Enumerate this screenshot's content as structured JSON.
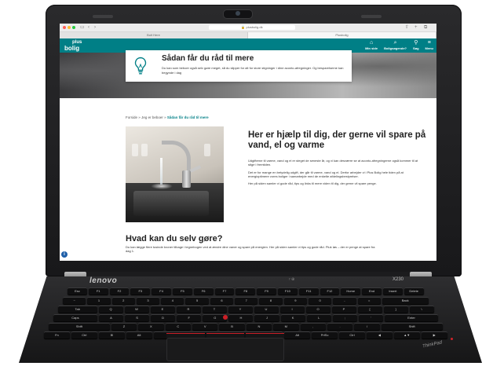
{
  "browser": {
    "url": "plusbolig.dk",
    "tabs": [
      {
        "label": "Bolt Here"
      },
      {
        "label": "Plusbolig"
      }
    ]
  },
  "site_nav": {
    "logo_plus": "plus",
    "logo_bolig": "bolig",
    "items": [
      {
        "icon": "user-icon",
        "glyph": "⌂",
        "label": "Min side"
      },
      {
        "icon": "search-house-icon",
        "glyph": "⌕",
        "label": "Boligsøgende?"
      },
      {
        "icon": "search-icon",
        "glyph": "⚲",
        "label": "Søg"
      },
      {
        "icon": "menu-icon",
        "glyph": "≡",
        "label": "Menu"
      }
    ]
  },
  "info_card": {
    "title": "Sådan får du råd til mere",
    "text": "Du kan som beboer også selv gøre meget, så du slipper for alt for store stigninger i dine aconto-afregninger. Og besparelserne kan begynde i dag"
  },
  "breadcrumb": {
    "items": [
      "Forside",
      "Jeg er beboer",
      "Sådan får du råd til mere"
    ],
    "separator": "»"
  },
  "article": {
    "title": "Her er hjælp til dig, der gerne vil spare på vand, el og varme",
    "paragraphs": [
      "Udgifterne til varme, vand og el er steget de seneste år, og vi kan desværre se at aconto-afregningerne også kommer til at stige i fremtiden.",
      "Det er for mange en betydelig udgift, der går til varme, vand og el. Derfor arbejder vi i Plus Bolig hele tiden på at energioptimere vores boliger i samarbejde med de enkelte afdelingsbestyrelser.",
      "Her på siden samler vi gode råd, tips og links til mere viden til dig, der gerne vil spare penge."
    ]
  },
  "section": {
    "title": "Hvad kan du selv gøre?",
    "text": "Du kan lægge flere tusinde kroner tilbage i tegnebogen ved at ændre dine vaner og spare på energien. Her på siden samler vi tips og gode råd. Pluk løs – der er penge at spare fra dag 1."
  },
  "help_badge": "i",
  "laptop": {
    "brand": "lenovo",
    "model": "X230",
    "status_leds": "ᵞ ⊕",
    "logo": "ThinkPad"
  },
  "keyboard": {
    "row1": [
      "Esc",
      "F1",
      "F2",
      "F3",
      "F4",
      "F5",
      "F6",
      "F7",
      "F8",
      "F9",
      "F10",
      "F11",
      "F12",
      "Home",
      "End",
      "Insert",
      "Delete"
    ],
    "row2": [
      "~",
      "1",
      "2",
      "3",
      "4",
      "5",
      "6",
      "7",
      "8",
      "9",
      "0",
      "-",
      "=",
      "Back"
    ],
    "row3": [
      "Tab",
      "Q",
      "W",
      "E",
      "R",
      "T",
      "Y",
      "U",
      "I",
      "O",
      "P",
      "[",
      "]",
      "\\"
    ],
    "row4": [
      "Caps",
      "A",
      "S",
      "D",
      "F",
      "G",
      "H",
      "J",
      "K",
      "L",
      ";",
      "'",
      "Enter"
    ],
    "row5": [
      "Shift",
      "Z",
      "X",
      "C",
      "V",
      "B",
      "N",
      "M",
      ",",
      ".",
      "/",
      "Shift"
    ],
    "row6": [
      "Fn",
      "Ctrl",
      "⊞",
      "Alt",
      "",
      "Alt",
      "PrtSc",
      "Ctrl",
      "◀",
      "▲▼",
      "▶"
    ]
  },
  "colors": {
    "brand_teal": "#007f86",
    "trackpoint_red": "#cc1f27"
  }
}
